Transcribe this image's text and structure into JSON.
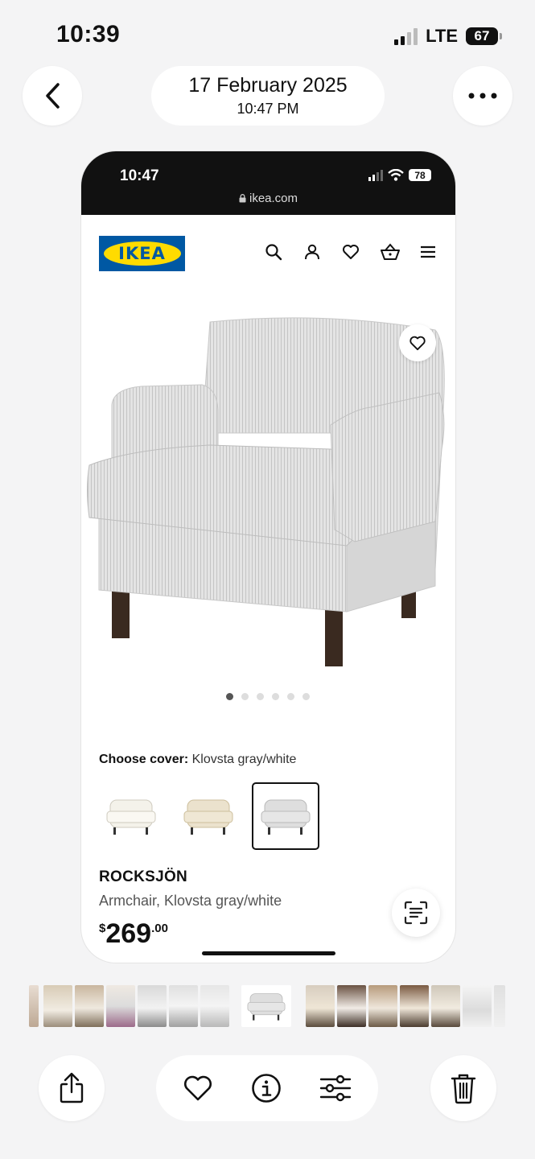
{
  "status_bar": {
    "time": "10:39",
    "network": "LTE",
    "battery": "67"
  },
  "header": {
    "date": "17 February 2025",
    "time": "10:47 PM"
  },
  "screenshot": {
    "status_bar": {
      "time": "10:47",
      "battery": "78"
    },
    "url": "ikea.com",
    "brand": "IKEA",
    "image_dots": {
      "count": 6,
      "active": 1
    },
    "cover": {
      "label": "Choose cover:",
      "value": "Klovsta gray/white"
    },
    "swatches": [
      {
        "name": "white-cover"
      },
      {
        "name": "beige-cover"
      },
      {
        "name": "gray-white-cover",
        "selected": true
      }
    ],
    "product": {
      "name": "ROCKSJÖN",
      "description": "Armchair, Klovsta gray/white",
      "price_currency": "$",
      "price_int": "269",
      "price_dec": ".00"
    }
  },
  "bottom_bar": [
    "share-icon",
    "heart-icon",
    "info-icon",
    "adjust-icon",
    "trash-icon"
  ],
  "colors": {
    "ikea_blue": "#0058a3",
    "ikea_yellow": "#ffdb00"
  }
}
